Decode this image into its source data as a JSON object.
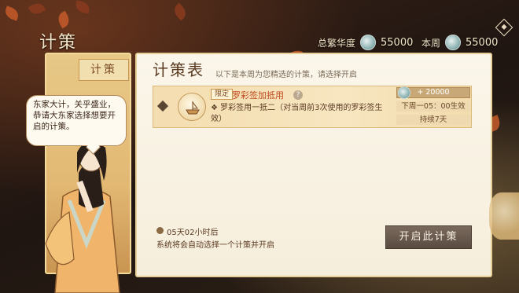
{
  "header": {
    "title": "计策",
    "total_label": "总繁华度",
    "total_value": "55000",
    "week_label": "本周",
    "week_value": "55000"
  },
  "left": {
    "tab": "计策",
    "speech": "东家大计，关乎盛业，恭请大东家选择想要开启的计策。"
  },
  "main": {
    "title": "计策表",
    "subtitle": "以下是本周为您精选的计策，请选择开启",
    "card": {
      "badge": "限定",
      "name": "罗彩签加抵用",
      "help": "?",
      "bullet": "❖",
      "desc": "罗彩签用一抵二（对当周前3次使用的罗彩签生效）",
      "cost": "+ 20000",
      "time": "下周一05：00生效",
      "duration": "持续7天"
    },
    "timer": "05天02小时后",
    "notice": "系统将会自动选择一个计策并开启",
    "start_button": "开启此计策"
  },
  "colors": {
    "accent_red": "#c24a1f",
    "panel": "#fbf6ea",
    "gold": "#e2b873"
  }
}
